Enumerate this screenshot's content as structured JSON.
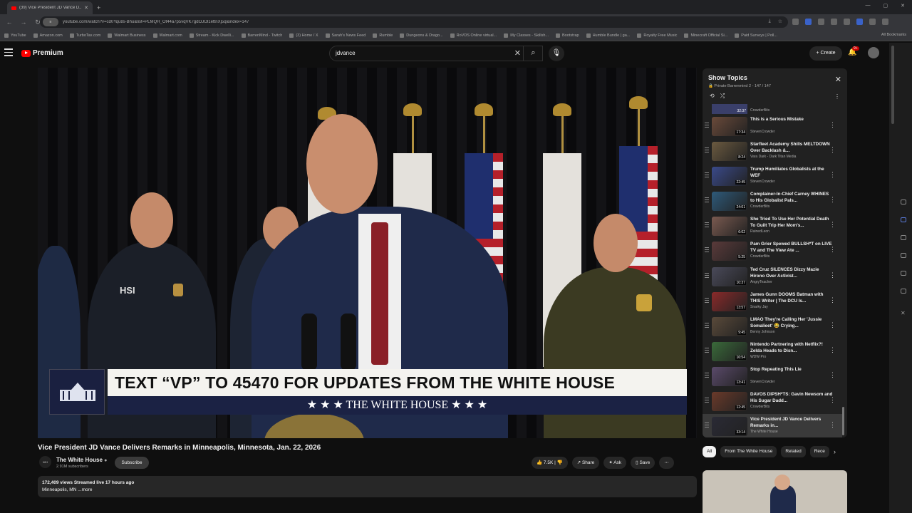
{
  "browser": {
    "tab_title": "(39) Vice President JD Vance D...",
    "url": "youtube.com/watch?v=cd0Yqu8s-Bhu&list=PLMQH_Ot44a7p5vqVK7gdOJOl1ettnXj5q&index=147",
    "all_bookmarks": "All Bookmarks",
    "bookmarks": [
      "YouTube",
      "Amazon.com",
      "TurboTax.com",
      "Walmart Business",
      "Walmart.com",
      "Stream - Kick Dwelli...",
      "BarrenMind - Twitch",
      "(3) Home / X",
      "Sarah's News Feed",
      "Rumble",
      "Dungeons & Drago...",
      "RoVDS Online virtual...",
      "My Classes - Skillsh...",
      "Bootstrap",
      "Humble Bundle | ga...",
      "Royalty Free Music",
      "Minecraft Official Si...",
      "Paid Surveys | Poll..."
    ]
  },
  "header": {
    "logo": "Premium",
    "search_value": "jdvance",
    "create": "Create",
    "notifications": "9+"
  },
  "video": {
    "lower_third_top": "TEXT “VP” TO 45470 FOR UPDATES FROM THE WHITE HOUSE",
    "lower_third_bottom": "★ ★ ★   THE WHITE HOUSE   ★ ★ ★",
    "hsi_text": "HSI",
    "title": "Vice President JD Vance Delivers Remarks in Minneapolis, Minnesota, Jan. 22, 2026",
    "channel": "The White House",
    "subscribers": "2.91M subscribers",
    "subscribe": "Subscribe",
    "likes": "7.5K",
    "share": "Share",
    "ask": "Ask",
    "save": "Save",
    "desc_line1": "172,409 views  Streamed live 17 hours ago",
    "desc_line2": "Minneapolis, MN ...more"
  },
  "playlist": {
    "title": "Show Topics",
    "subtitle": "Private  Barrenmind 2 - 147 / 147",
    "partial_channel": "CrowderBits",
    "partial_duration": "32:37",
    "items": [
      {
        "title": "This is a Serious Mistake",
        "channel": "StevenCrowder",
        "duration": "17:34",
        "color": "#6a4a3a"
      },
      {
        "title": "Starfleet Academy Shills MELTDOWN Over Backlash &...",
        "channel": "Vara Dark - Dark Titan Media",
        "duration": "8:24",
        "color": "#6b5a40"
      },
      {
        "title": "Trump Humiliates Globalists at the WEF",
        "channel": "StevenCrowder",
        "duration": "22:45",
        "color": "#3a4a8a"
      },
      {
        "title": "Complainer-In-Chief Carney WHINES to His Globalist Pals...",
        "channel": "CrowderBits",
        "duration": "24:01",
        "color": "#2e5a7a"
      },
      {
        "title": "She Tried To Use Her Potential Death To Guilt Trip Her Mom's...",
        "channel": "RuinedLeon",
        "duration": "6:02",
        "color": "#7a5a50"
      },
      {
        "title": "Pam Grier Spewed BULLSH*T on LIVE TV and The View Ate ...",
        "channel": "CrowderBits",
        "duration": "5:25",
        "color": "#5a3a3a"
      },
      {
        "title": "Ted Cruz SILENCES Dizzy Mazie Hirono Over Activist...",
        "channel": "AngryTeacher",
        "duration": "10:37",
        "color": "#4a4a5a"
      },
      {
        "title": "James Gunn DOOMS Batman with THIS Writer | The DCU Is...",
        "channel": "Snarky Jay",
        "duration": "13:57",
        "color": "#8a2a2a"
      },
      {
        "title": "LMAO They're Calling Her 'Jussie Somalieet' 😂 Crying...",
        "channel": "Benny Johnson",
        "duration": "9:45",
        "color": "#5a4a3a"
      },
      {
        "title": "Nintendo Partnering with Netflix?! Zelda Heads to Disn...",
        "channel": "WDW Pro",
        "duration": "16:54",
        "color": "#3a6a3a"
      },
      {
        "title": "Stop Repeating This Lie",
        "channel": "StevenCrowder",
        "duration": "13:41",
        "color": "#5a4a6a"
      },
      {
        "title": "DAVOS DIPSH*TS: Gavin Newsom and His Sugar Dadd...",
        "channel": "CrowderBits",
        "duration": "12:45",
        "color": "#6a3a2a"
      },
      {
        "title": "Vice President JD Vance Delivers Remarks in...",
        "channel": "The White House",
        "duration": "33:14",
        "color": "#2a2a35"
      }
    ]
  },
  "chips": [
    "All",
    "From The White House",
    "Related",
    "Rece"
  ],
  "colors": {
    "background": "#0f0f0f",
    "accent": "#ff0000",
    "flag_blue": "#1f2f6e",
    "lower_third_navy": "#1b2244"
  }
}
